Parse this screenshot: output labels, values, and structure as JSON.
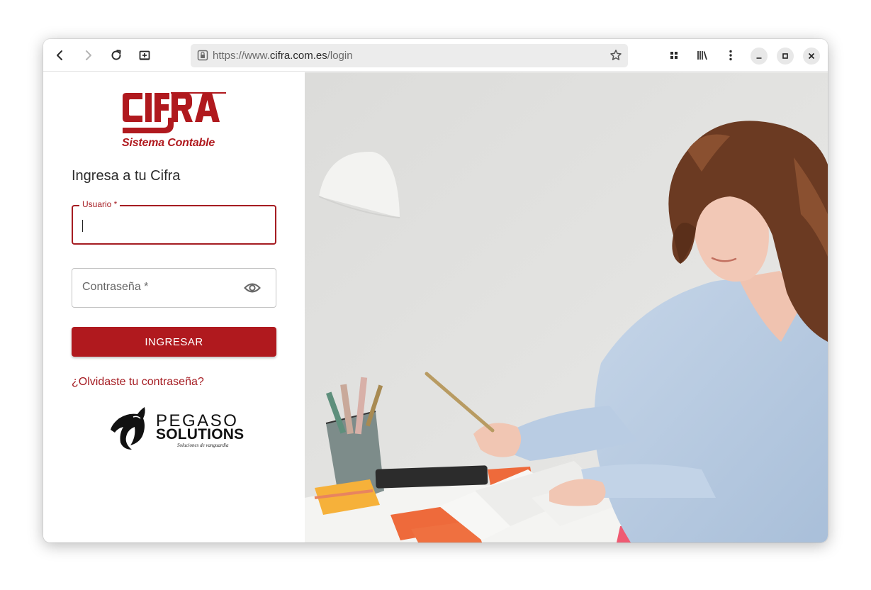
{
  "browser": {
    "url_scheme": "https://www.",
    "url_domain": "cifra.com.es",
    "url_path": "/login"
  },
  "brand": {
    "logo_text": "CIFRA",
    "logo_subtitle": "Sistema Contable",
    "color": "#b0191e"
  },
  "login": {
    "heading": "Ingresa a tu Cifra",
    "user_label": "Usuario *",
    "password_placeholder": "Contraseña *",
    "submit_label": "INGRESAR",
    "forgot_link": "¿Olvidaste tu contraseña?"
  },
  "footer_logo": {
    "name_line1": "PEGASO",
    "name_line2": "SOLUTIONS",
    "tagline": "Soluciones de vanguardia"
  },
  "icons": {
    "back": "back-arrow-icon",
    "forward": "forward-arrow-icon",
    "reload": "reload-icon",
    "new_tab": "new-tab-icon",
    "lock": "lock-icon",
    "bookmark": "star-icon",
    "extensions": "grid-icon",
    "library": "library-icon",
    "menu": "kebab-menu-icon",
    "password_toggle": "eye-icon"
  }
}
